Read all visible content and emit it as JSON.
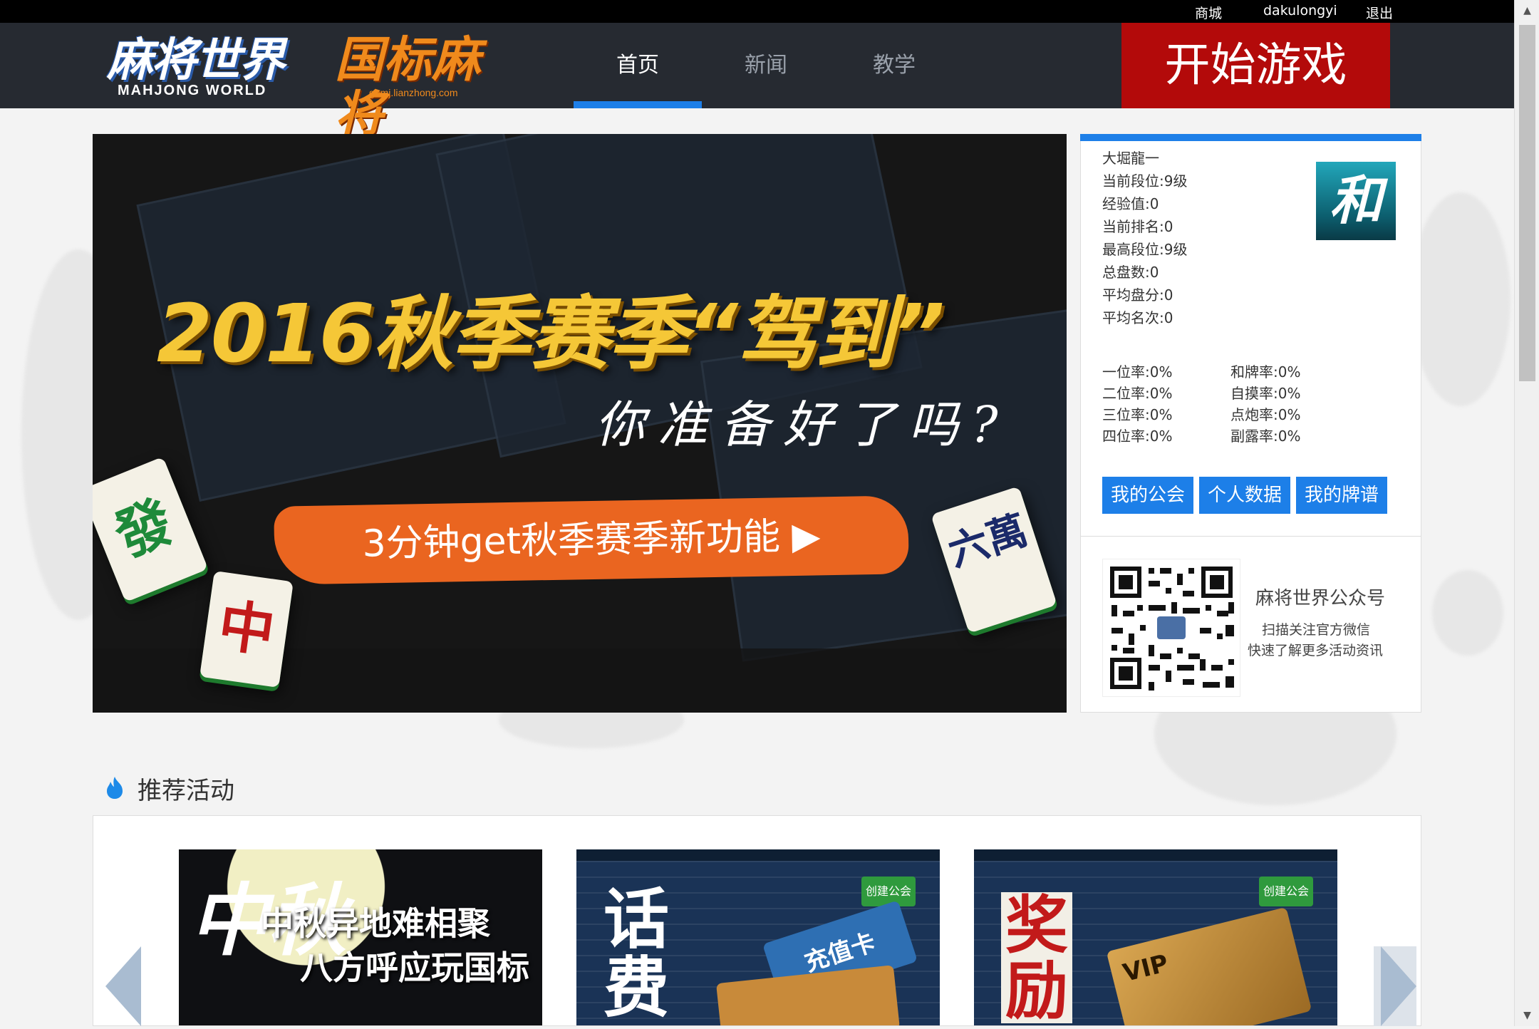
{
  "topbar": {
    "shop": "商城",
    "username": "dakulongyi",
    "logout": "退出"
  },
  "logos": {
    "mahjong_world": "麻将世界",
    "mahjong_world_en": "MAHJONG WORLD",
    "gbmj": "国标麻将",
    "gbmj_url": "gbmj.lianzhong.com"
  },
  "nav": {
    "tabs": [
      "首页",
      "新闻",
      "教学"
    ],
    "active": "首页"
  },
  "start_button": "开始游戏",
  "banner": {
    "headline": "2016秋季赛季“驾到”",
    "subline": "你准备好了吗?",
    "cta": "3分钟get秋季赛季新功能",
    "tiles": [
      "發",
      "中",
      "六萬"
    ]
  },
  "profile": {
    "name": "大堀龍一",
    "stats": [
      "当前段位:9级",
      "经验值:0",
      "当前排名:0",
      "最高段位:9级",
      "总盘数:0",
      "平均盘分:0",
      "平均名次:0"
    ],
    "avatar_char": "和",
    "rates_left": [
      "一位率:0%",
      "二位率:0%",
      "三位率:0%",
      "四位率:0%"
    ],
    "rates_right": [
      "和牌率:0%",
      "自摸率:0%",
      "点炮率:0%",
      "副露率:0%"
    ],
    "buttons": [
      "我的公会",
      "个人数据",
      "我的牌谱"
    ],
    "qr_title": "麻将世界公众号",
    "qr_line1": "扫描关注官方微信",
    "qr_line2": "快速了解更多活动资讯"
  },
  "activities": {
    "title": "推荐活动",
    "cards": [
      {
        "line1": "中秋异地难相聚",
        "line2": "八方呼应玩国标",
        "char": "中秋"
      },
      {
        "big": "话费",
        "label": "充值卡",
        "button": "创建公会"
      },
      {
        "big": "奖励",
        "label": "VIP",
        "button": "创建公会"
      }
    ]
  },
  "colors": {
    "accent": "#1d7fe8",
    "start": "#b30a0a",
    "header": "#262a31"
  }
}
